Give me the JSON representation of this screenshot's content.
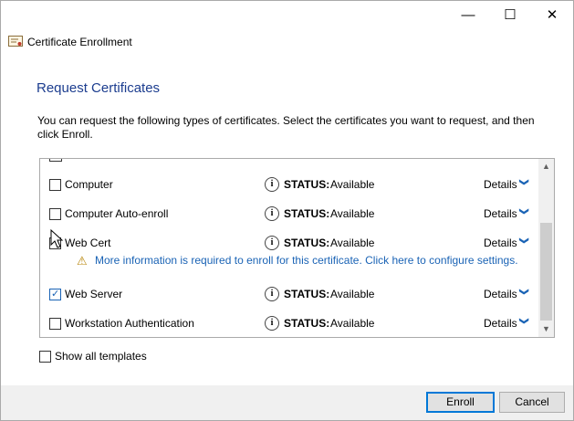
{
  "window": {
    "minimize_glyph": "—",
    "maximize_glyph": "☐",
    "close_glyph": "✕"
  },
  "header": {
    "icon": "certificate-icon",
    "title": "Certificate Enrollment"
  },
  "main": {
    "title": "Request Certificates",
    "intro": "You can request the following types of certificates. Select the certificates you want to request, and then click Enroll."
  },
  "certificates": [
    {
      "name": "Computer",
      "checked": false,
      "status_label": "STATUS:",
      "status": "Available",
      "details": "Details"
    },
    {
      "name": "Computer Auto-enroll",
      "checked": false,
      "status_label": "STATUS:",
      "status": "Available",
      "details": "Details"
    },
    {
      "name": "Web Cert",
      "checked": false,
      "status_label": "STATUS:",
      "status": "Available",
      "details": "Details"
    },
    {
      "name": "Web Server",
      "checked": true,
      "status_label": "STATUS:",
      "status": "Available",
      "details": "Details"
    },
    {
      "name": "Workstation Authentication",
      "checked": false,
      "status_label": "STATUS:",
      "status": "Available",
      "details": "Details"
    }
  ],
  "warning": {
    "text": "More information is required to enroll for this certificate. Click here to configure settings."
  },
  "show_all": {
    "label": "Show all templates",
    "checked": false
  },
  "footer": {
    "enroll_label": "Enroll",
    "cancel_label": "Cancel"
  },
  "colors": {
    "title_blue": "#1c3d8f",
    "link_blue": "#1a63b5",
    "accent": "#0078d7"
  }
}
